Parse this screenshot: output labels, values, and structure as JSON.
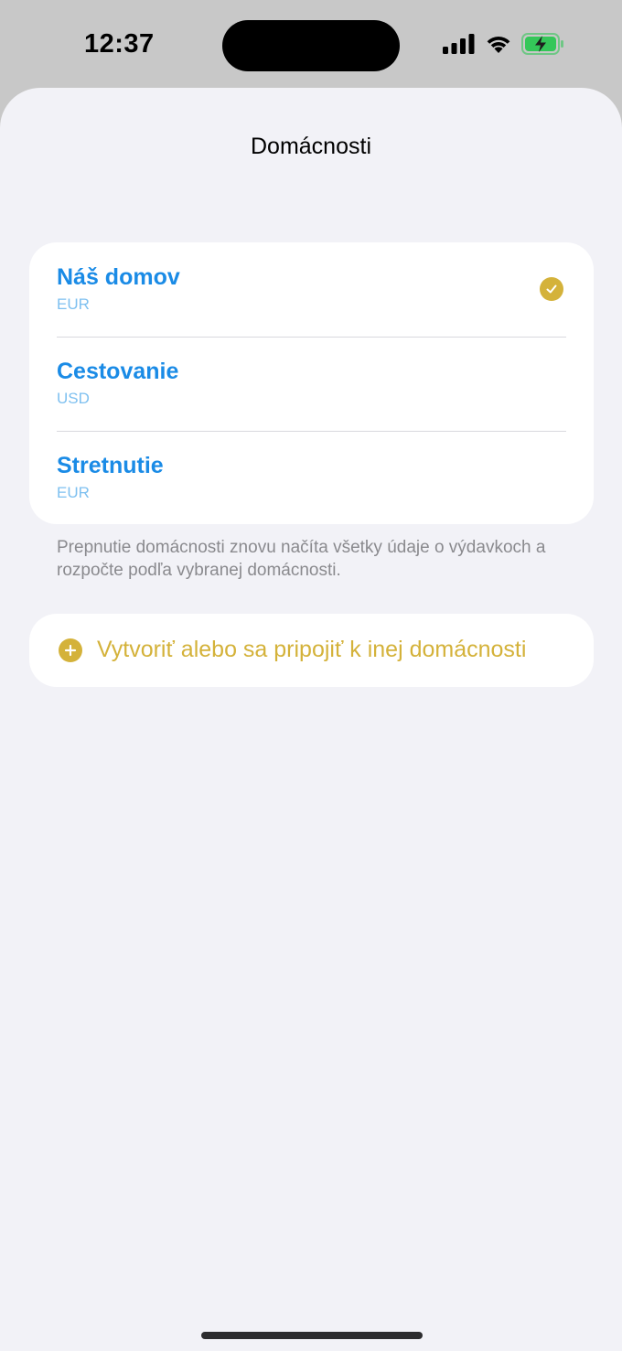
{
  "status_bar": {
    "time": "12:37",
    "icons": [
      "signal-icon",
      "wifi-icon",
      "battery-charging-icon"
    ],
    "battery_color": "#34c759"
  },
  "sheet": {
    "title": "Domácnosti"
  },
  "households": [
    {
      "name": "Náš domov",
      "currency": "EUR",
      "selected": true
    },
    {
      "name": "Cestovanie",
      "currency": "USD",
      "selected": false
    },
    {
      "name": "Stretnutie",
      "currency": "EUR",
      "selected": false
    }
  ],
  "footnote": "Prepnutie domácnosti znovu načíta všetky údaje o výdavkoch a rozpočte podľa vybranej domácnosti.",
  "action": {
    "label": "Vytvoriť alebo sa pripojiť k inej domácnosti",
    "icon": "plus-circle-icon"
  },
  "colors": {
    "accent": "#d4b23a",
    "link": "#1a8be6",
    "background": "#f2f2f7"
  }
}
